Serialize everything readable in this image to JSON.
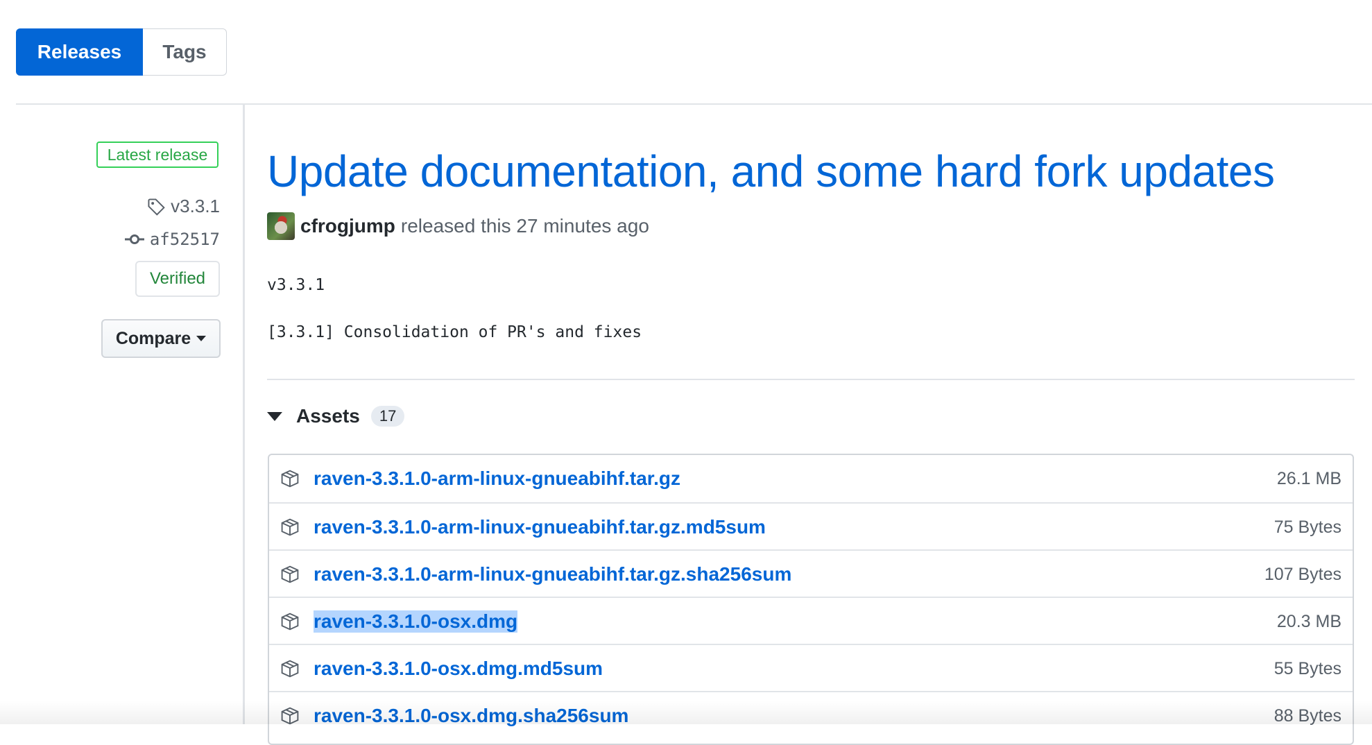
{
  "tabs": {
    "releases": "Releases",
    "tags": "Tags"
  },
  "sidebar": {
    "latest_badge": "Latest release",
    "tag": "v3.3.1",
    "commit": "af52517",
    "verified": "Verified",
    "compare": "Compare"
  },
  "release": {
    "title": "Update documentation, and some hard fork updates",
    "author": "cfrogjump",
    "released_text": "released this 27 minutes ago",
    "body_version": "v3.3.1",
    "body_notes": "[3.3.1] Consolidation of PR's and fixes"
  },
  "assets": {
    "label": "Assets",
    "count": "17",
    "items": [
      {
        "name": "raven-3.3.1.0-arm-linux-gnueabihf.tar.gz",
        "size": "26.1 MB"
      },
      {
        "name": "raven-3.3.1.0-arm-linux-gnueabihf.tar.gz.md5sum",
        "size": "75 Bytes"
      },
      {
        "name": "raven-3.3.1.0-arm-linux-gnueabihf.tar.gz.sha256sum",
        "size": "107 Bytes"
      },
      {
        "name": "raven-3.3.1.0-osx.dmg",
        "size": "20.3 MB"
      },
      {
        "name": "raven-3.3.1.0-osx.dmg.md5sum",
        "size": "55 Bytes"
      },
      {
        "name": "raven-3.3.1.0-osx.dmg.sha256sum",
        "size": "88 Bytes"
      }
    ]
  },
  "icons": {
    "tag": "tag-icon",
    "commit": "git-commit-icon",
    "package": "package-icon",
    "caret": "caret-down-icon",
    "triangle": "triangle-down-icon"
  },
  "colors": {
    "accent": "#0366d6",
    "green": "#28a745",
    "border": "#e1e4e8"
  }
}
